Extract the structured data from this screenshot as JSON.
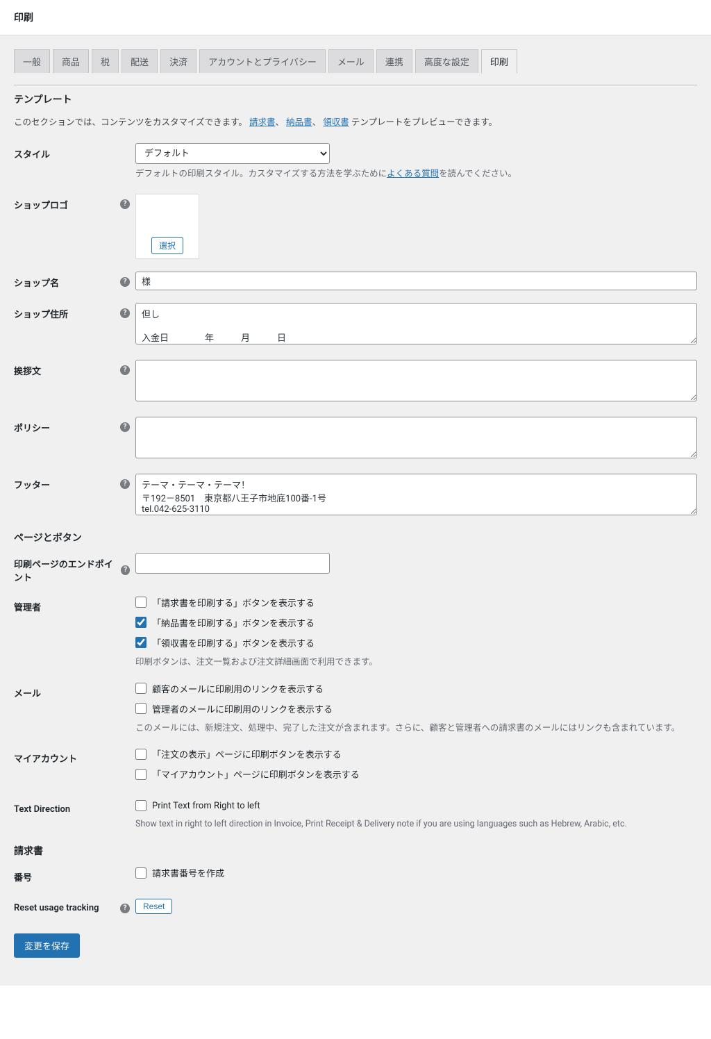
{
  "header": {
    "title": "印刷"
  },
  "tabs": [
    "一般",
    "商品",
    "税",
    "配送",
    "決済",
    "アカウントとプライバシー",
    "メール",
    "連携",
    "高度な設定",
    "印刷"
  ],
  "active_tab": "印刷",
  "section_template": "テンプレート",
  "intro": {
    "pre": "このセクションでは、コンテンツをカスタマイズできます。",
    "link1": "請求書",
    "sep1": "、",
    "link2": "納品書",
    "sep2": "、",
    "link3": "領収書",
    "post": " テンプレートをプレビューできます。"
  },
  "style": {
    "label": "スタイル",
    "value": "デフォルト",
    "help_pre": "デフォルトの印刷スタイル。カスタマイズする方法を学ぶために",
    "help_link": "よくある質問",
    "help_post": "を読んでください。"
  },
  "logo": {
    "label": "ショップロゴ",
    "button": "選択"
  },
  "shop_name": {
    "label": "ショップ名",
    "value": "様"
  },
  "shop_address": {
    "label": "ショップ住所",
    "value": "但し\n\n入金日　　　　年　　　月　　　日"
  },
  "greeting": {
    "label": "挨拶文",
    "value": ""
  },
  "policy": {
    "label": "ポリシー",
    "value": ""
  },
  "footer": {
    "label": "フッター",
    "value": "テーマ・テーマ・テーマ！\n〒192－8501　東京都八王子市地底100番-1号\ntel.042-625-3110"
  },
  "section_pages": "ページとボタン",
  "endpoint": {
    "label": "印刷ページのエンドポイント",
    "value": ""
  },
  "admin": {
    "label": "管理者",
    "opts": [
      {
        "text": "「請求書を印刷する」ボタンを表示する",
        "checked": false
      },
      {
        "text": "「納品書を印刷する」ボタンを表示する",
        "checked": true
      },
      {
        "text": "「領収書を印刷する」ボタンを表示する",
        "checked": true
      }
    ],
    "help": "印刷ボタンは、注文一覧および注文詳細画面で利用できます。"
  },
  "mail": {
    "label": "メール",
    "opts": [
      {
        "text": "顧客のメールに印刷用のリンクを表示する",
        "checked": false
      },
      {
        "text": "管理者のメールに印刷用のリンクを表示する",
        "checked": false
      }
    ],
    "help": "このメールには、新規注文、処理中、完了した注文が含まれます。さらに、顧客と管理者への請求書のメールにはリンクも含まれています。"
  },
  "myaccount": {
    "label": "マイアカウント",
    "opts": [
      {
        "text": "「注文の表示」ページに印刷ボタンを表示する",
        "checked": false
      },
      {
        "text": "「マイアカウント」ページに印刷ボタンを表示する",
        "checked": false
      }
    ]
  },
  "textdir": {
    "label": "Text Direction",
    "opt": "Print Text from Right to left",
    "checked": false,
    "help": "Show text in right to left direction in Invoice, Print Receipt & Delivery note if you are using languages such as Hebrew, Arabic, etc."
  },
  "section_invoice": "請求書",
  "invoice_no": {
    "label": "番号",
    "opt": "請求書番号を作成",
    "checked": false
  },
  "reset": {
    "label": "Reset usage tracking",
    "button": "Reset"
  },
  "save": "変更を保存"
}
